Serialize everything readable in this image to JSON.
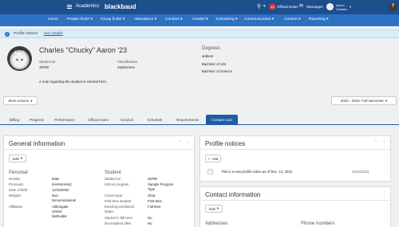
{
  "topbar": {
    "app_name": "Academics",
    "brand": "blackbaud",
    "official_notes": "Official Notes",
    "notes_count": "15",
    "messages": "Messages",
    "user_line1": "Aaron",
    "user_line2": "Charles"
  },
  "nav": [
    "Home",
    "People finder",
    "Group finder",
    "Attendance",
    "Conduct",
    "Grades",
    "Scheduling",
    "Communication",
    "Content",
    "Reporting"
  ],
  "profile_notice_bar": {
    "label": "Profile notices",
    "link": "See details"
  },
  "student": {
    "name": "Charles \"Chucky\" Aaron '23",
    "id_label": "Student ID",
    "id_value": "48789",
    "class_label": "Classification",
    "class_value": "Sophomore",
    "note": "A note regarding the student is entered here.",
    "degrees_label": "Degrees",
    "degrees": [
      "anbtest",
      "Bachelor of Arts",
      "Bachelor of Science"
    ]
  },
  "more_actions": "More actions",
  "semester": "2022 - 2023: Fall Semester",
  "tabs": [
    "Billing",
    "Progress",
    "Performance",
    "Official notes",
    "Conduct",
    "Schedule",
    "Requirements",
    "Contact card"
  ],
  "general_info": {
    "title": "General information",
    "edit": "Edit",
    "personal_heading": "Personal",
    "personal": [
      {
        "label": "Gender",
        "value": "Male"
      },
      {
        "label": "Pronouns",
        "value": "(He/Him/His)"
      },
      {
        "label": "Date of birth",
        "value": "12/15/2002"
      },
      {
        "label": "Religion",
        "value": "Non Denominational"
      },
      {
        "label": "Affiliation",
        "value": "Aldersgate United Methodist"
      }
    ],
    "student_heading": "Student",
    "student": [
      {
        "label": "Student Id",
        "value": "48789"
      },
      {
        "label": "School program",
        "value": "Sample Program Type"
      },
      {
        "label": "Cohort year",
        "value": "2016"
      },
      {
        "label": "First-time student",
        "value": "First-time"
      },
      {
        "label": "Entering enrollment status",
        "value": "Full-time"
      },
      {
        "label": "Started in fall term",
        "value": "No"
      },
      {
        "label": "Nonresident alien",
        "value": "No"
      }
    ]
  },
  "profile_notices": {
    "title": "Profile notices",
    "add": "Add",
    "items": [
      {
        "text": "This is a new profile notice as of Dec. 14, 2022",
        "date": "12/14/2022"
      }
    ]
  },
  "contact_info": {
    "title": "Contact information",
    "edit": "Edit",
    "addresses": "Addresses",
    "phone_numbers": "Phone numbers"
  },
  "colors": {
    "topbar": "#1c4f8c",
    "navbar": "#2d71c4",
    "active_tab": "#1e5da5",
    "notice_bg": "#d8edf8",
    "badge": "#d9363e"
  }
}
